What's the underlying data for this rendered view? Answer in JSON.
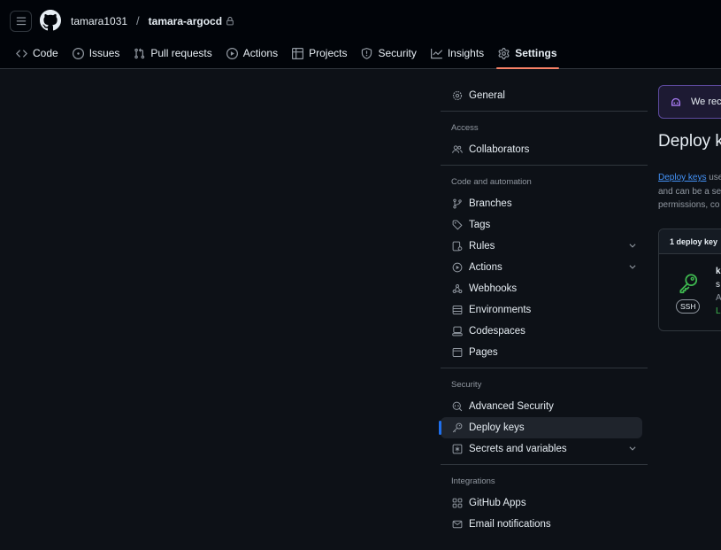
{
  "header": {
    "owner": "tamara1031",
    "separator": "/",
    "repo": "tamara-argocd"
  },
  "tabs": [
    {
      "label": "Code",
      "icon": "code-icon"
    },
    {
      "label": "Issues",
      "icon": "issue-icon"
    },
    {
      "label": "Pull requests",
      "icon": "pull-request-icon"
    },
    {
      "label": "Actions",
      "icon": "play-icon"
    },
    {
      "label": "Projects",
      "icon": "table-icon"
    },
    {
      "label": "Security",
      "icon": "shield-icon"
    },
    {
      "label": "Insights",
      "icon": "graph-icon"
    },
    {
      "label": "Settings",
      "icon": "gear-icon",
      "active": true
    }
  ],
  "sidebar": {
    "general": "General",
    "access": {
      "heading": "Access",
      "items": [
        "Collaborators"
      ]
    },
    "code_automation": {
      "heading": "Code and automation",
      "items": [
        "Branches",
        "Tags",
        "Rules",
        "Actions",
        "Webhooks",
        "Environments",
        "Codespaces",
        "Pages"
      ]
    },
    "security": {
      "heading": "Security",
      "items": [
        "Advanced Security",
        "Deploy keys",
        "Secrets and variables"
      ]
    },
    "integrations": {
      "heading": "Integrations",
      "items": [
        "GitHub Apps",
        "Email notifications"
      ]
    }
  },
  "main": {
    "banner_text": "We reco",
    "title": "Deploy k",
    "desc_link": "Deploy keys",
    "desc_line1_rest": " use",
    "desc_line2": "and can be a se",
    "desc_line3": "permissions, co",
    "key_count": "1 deploy key",
    "key": {
      "badge": "SSH",
      "line1": "k",
      "line2": "s",
      "line3": "A",
      "line4": "L"
    }
  },
  "colors": {
    "accent_blue": "#1f6feb",
    "active_tab_underline": "#f78166",
    "key_icon_green": "#3fb950",
    "link": "#4493f8"
  }
}
